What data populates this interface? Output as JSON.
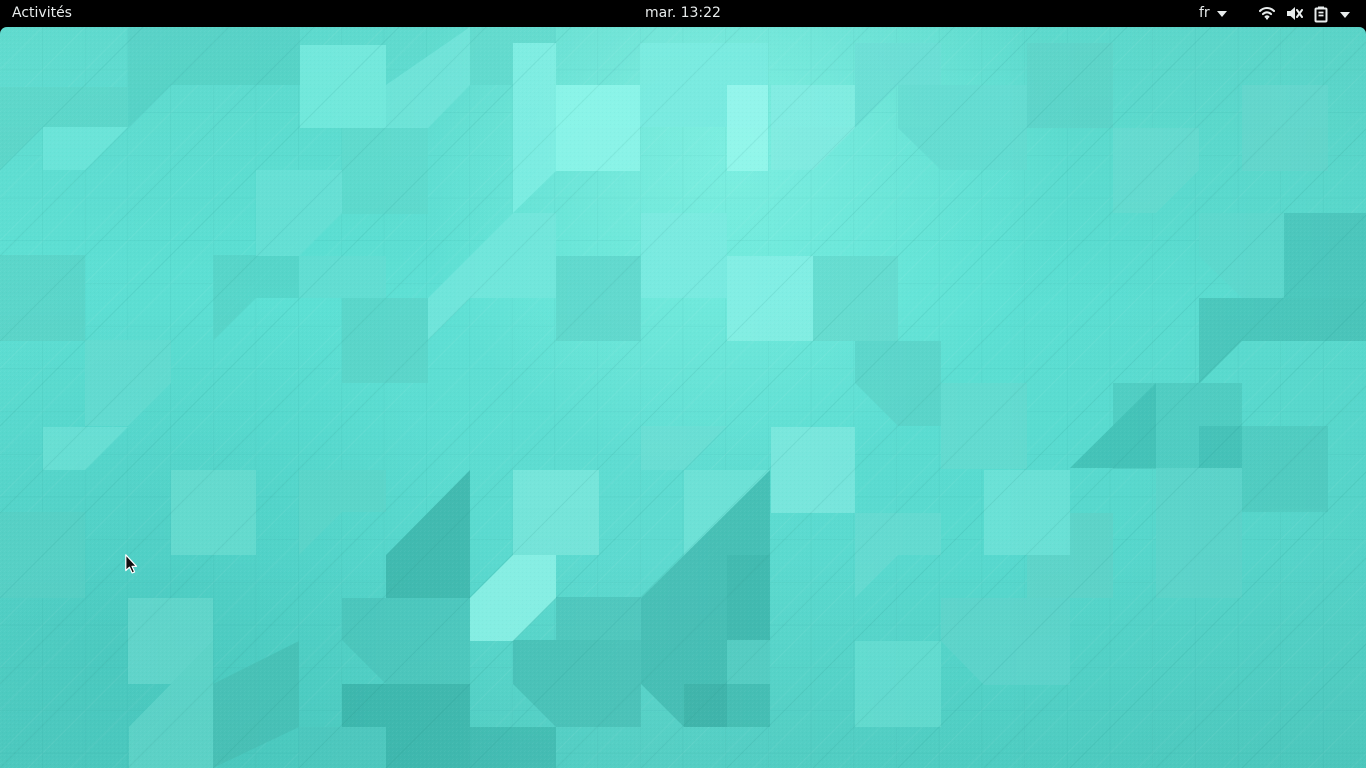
{
  "top_bar": {
    "activities_label": "Activités",
    "clock_label": "mar. 13:22",
    "keyboard_layout_label": "fr",
    "text_color": "#e8ecec"
  },
  "system_status": {
    "icons": [
      "network-wireless-icon",
      "audio-volume-muted-icon",
      "battery-icon",
      "chevron-down-icon"
    ]
  },
  "desktop": {
    "background_colors": [
      "#55d8cb",
      "#5ce0d4",
      "#81f5e5",
      "#3dbeb5"
    ]
  }
}
